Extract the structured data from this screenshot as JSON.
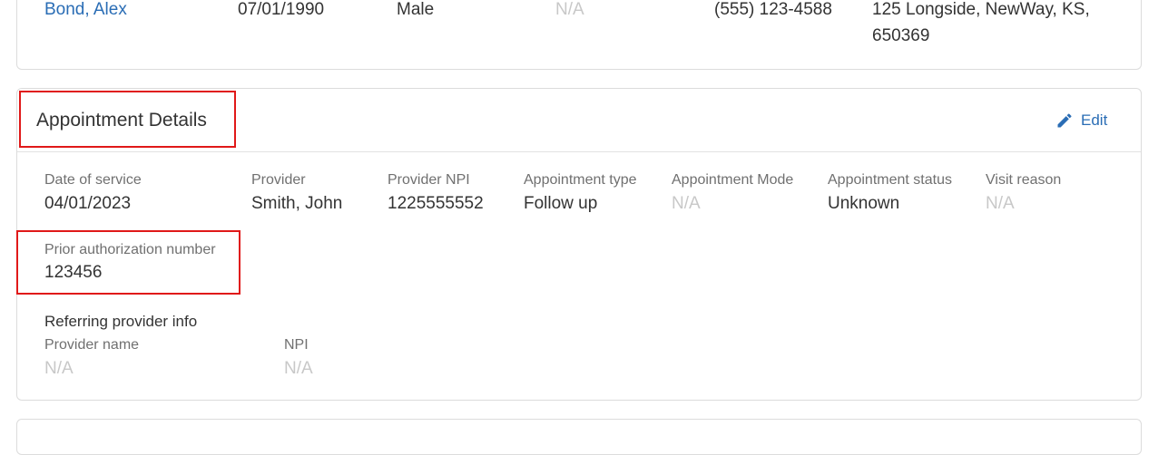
{
  "patient_row": {
    "name": "Bond, Alex",
    "dob": "07/01/1990",
    "gender": "Male",
    "field4": "N/A",
    "phone": "(555) 123-4588",
    "address_line1": "125 Longside, NewWay, KS,",
    "address_line2": "650369"
  },
  "appointment": {
    "title": "Appointment Details",
    "edit_label": "Edit",
    "edit_icon": "pencil-icon",
    "fields": {
      "date_of_service": {
        "label": "Date of service",
        "value": "04/01/2023"
      },
      "provider": {
        "label": "Provider",
        "value": "Smith, John"
      },
      "provider_npi": {
        "label": "Provider NPI",
        "value": "1225555552"
      },
      "appointment_type": {
        "label": "Appointment type",
        "value": "Follow up"
      },
      "appointment_mode": {
        "label": "Appointment Mode",
        "value": "N/A"
      },
      "appointment_status": {
        "label": "Appointment status",
        "value": "Unknown"
      },
      "visit_reason": {
        "label": "Visit reason",
        "value": "N/A"
      },
      "prior_auth": {
        "label": "Prior authorization number",
        "value": "123456"
      }
    },
    "referring": {
      "heading": "Referring provider info",
      "provider_name": {
        "label": "Provider name",
        "value": "N/A"
      },
      "npi": {
        "label": "NPI",
        "value": "N/A"
      }
    }
  },
  "colors": {
    "link": "#2a6db5",
    "highlight": "#e01919",
    "placeholder": "#c8c8c8"
  }
}
